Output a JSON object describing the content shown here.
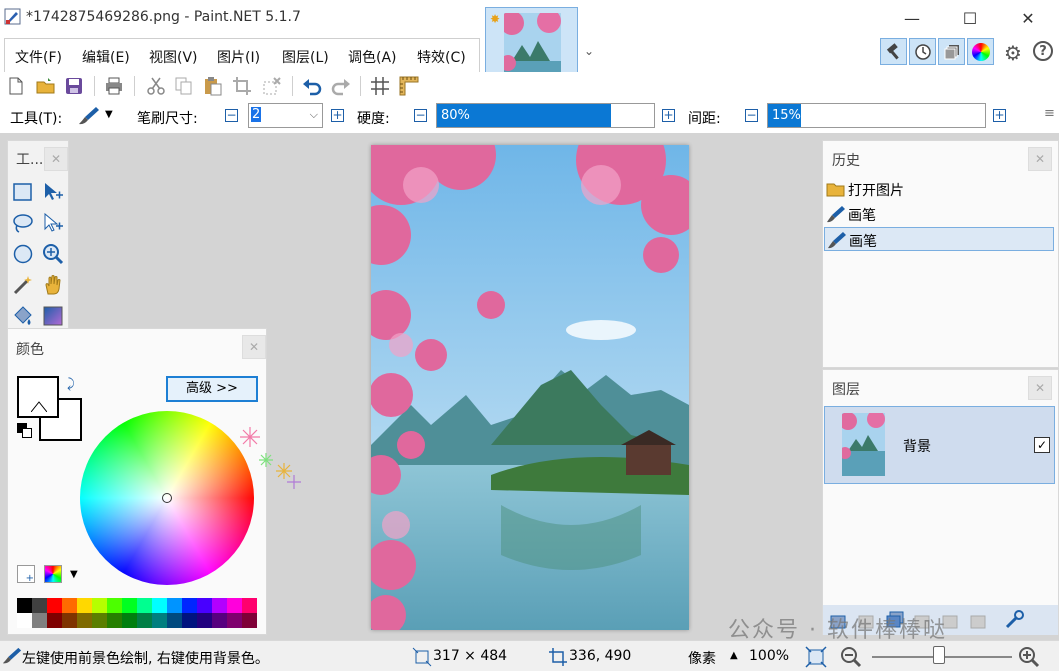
{
  "window": {
    "title": "*1742875469286.png - Paint.NET 5.1.7",
    "minimize": "—",
    "maximize": "☐",
    "close": "✕"
  },
  "menu": [
    "文件(F)",
    "编辑(E)",
    "视图(V)",
    "图片(I)",
    "图层(L)",
    "调色(A)",
    "特效(C)"
  ],
  "toolbar2": {
    "tool_label": "工具(T):",
    "brush_size_label": "笔刷尺寸:",
    "brush_size_value": "2",
    "hardness_label": "硬度:",
    "hardness_value": "80%",
    "hardness_fraction": 0.8,
    "spacing_label": "间距:",
    "spacing_value": "15%",
    "spacing_fraction": 0.15
  },
  "tools_panel": {
    "title": "工..."
  },
  "color_panel": {
    "title": "颜色",
    "advanced_button": "高级 >>",
    "primary_color": "#ffffff",
    "secondary_color": "#ffffff",
    "palette_row1": [
      "#000000",
      "#404040",
      "#ff0000",
      "#ff6a00",
      "#ffd800",
      "#b6ff00",
      "#4cff00",
      "#00ff21",
      "#00ff90",
      "#00ffff",
      "#0094ff",
      "#0026ff",
      "#4800ff",
      "#b200ff",
      "#ff00dc",
      "#ff006e"
    ],
    "palette_row2": [
      "#ffffff",
      "#808080",
      "#7f0000",
      "#7f3300",
      "#7f6a00",
      "#5b7f00",
      "#267f00",
      "#007f0e",
      "#007f46",
      "#007f7f",
      "#004a7f",
      "#00137f",
      "#21007f",
      "#57007f",
      "#7f006e",
      "#7f0037"
    ]
  },
  "history_panel": {
    "title": "历史",
    "items": [
      {
        "label": "打开图片",
        "icon": "folder-icon"
      },
      {
        "label": "画笔",
        "icon": "paintbrush-icon"
      },
      {
        "label": "画笔",
        "icon": "paintbrush-icon",
        "selected": true
      }
    ]
  },
  "layers_panel": {
    "title": "图层",
    "layers": [
      {
        "name": "背景",
        "visible": true
      }
    ]
  },
  "status": {
    "hint": "左键使用前景色绘制, 右键使用背景色。",
    "image_size": "317 × 484",
    "cursor_pos": "336, 490",
    "units": "像素",
    "zoom": "100%"
  },
  "watermark": "公众号 · 软件棒棒哒"
}
